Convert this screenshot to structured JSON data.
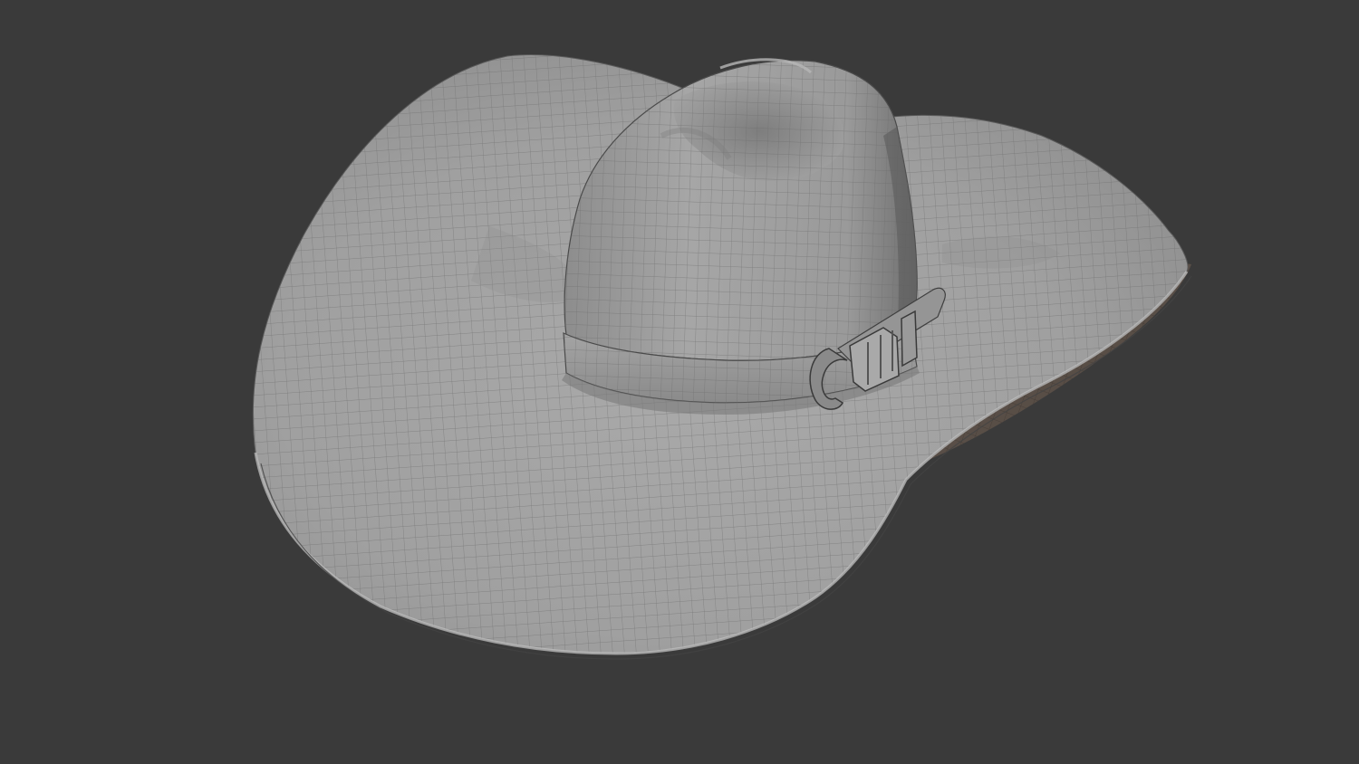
{
  "viewport": {
    "background_color": "#3a3a3a",
    "shading_mode": "solid-wireframe-overlay"
  },
  "model": {
    "object": "cowboy-hat",
    "base_color": "#9d9d9d",
    "wire_color": "#6b6b6b",
    "underside_color": "#5a4f46",
    "parts": [
      "brim",
      "crown",
      "hat-band",
      "band-buckle",
      "band-loop"
    ]
  }
}
